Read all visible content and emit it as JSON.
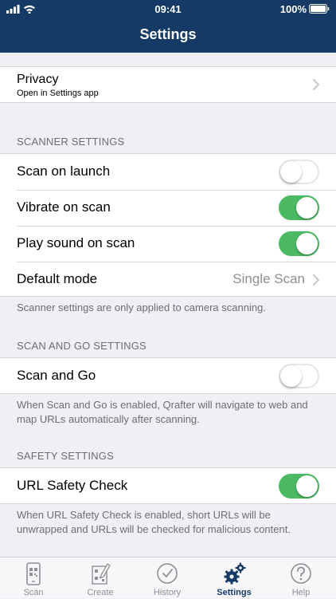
{
  "status_bar": {
    "time": "09:41",
    "battery": "100%"
  },
  "nav": {
    "title": "Settings"
  },
  "privacy": {
    "title": "Privacy",
    "subtitle": "Open in Settings app"
  },
  "scanner": {
    "header": "SCANNER SETTINGS",
    "scan_on_launch": {
      "label": "Scan on launch",
      "enabled": false
    },
    "vibrate_on_scan": {
      "label": "Vibrate on scan",
      "enabled": true
    },
    "play_sound_on_scan": {
      "label": "Play sound on scan",
      "enabled": true
    },
    "default_mode": {
      "label": "Default mode",
      "value": "Single Scan"
    },
    "footer": "Scanner settings are only applied to camera scanning."
  },
  "scan_and_go": {
    "header": "SCAN AND GO SETTINGS",
    "scan_and_go": {
      "label": "Scan and Go",
      "enabled": false
    },
    "footer": "When Scan and Go is enabled, Qrafter will navigate to web and map URLs automatically after scanning."
  },
  "safety": {
    "header": "SAFETY SETTINGS",
    "url_safety_check": {
      "label": "URL Safety Check",
      "enabled": true
    },
    "footer": "When URL Safety Check is enabled, short URLs will be unwrapped and URLs will be checked for malicious content."
  },
  "tabbar": {
    "active": "Settings",
    "tabs": [
      {
        "label": "Scan",
        "icon": "scan-icon"
      },
      {
        "label": "Create",
        "icon": "create-icon"
      },
      {
        "label": "History",
        "icon": "history-icon"
      },
      {
        "label": "Settings",
        "icon": "gears-icon"
      },
      {
        "label": "Help",
        "icon": "help-icon"
      }
    ]
  },
  "colors": {
    "nav_bar": "#163a66",
    "toggle_on": "#4cb963",
    "background": "#efeff4"
  }
}
